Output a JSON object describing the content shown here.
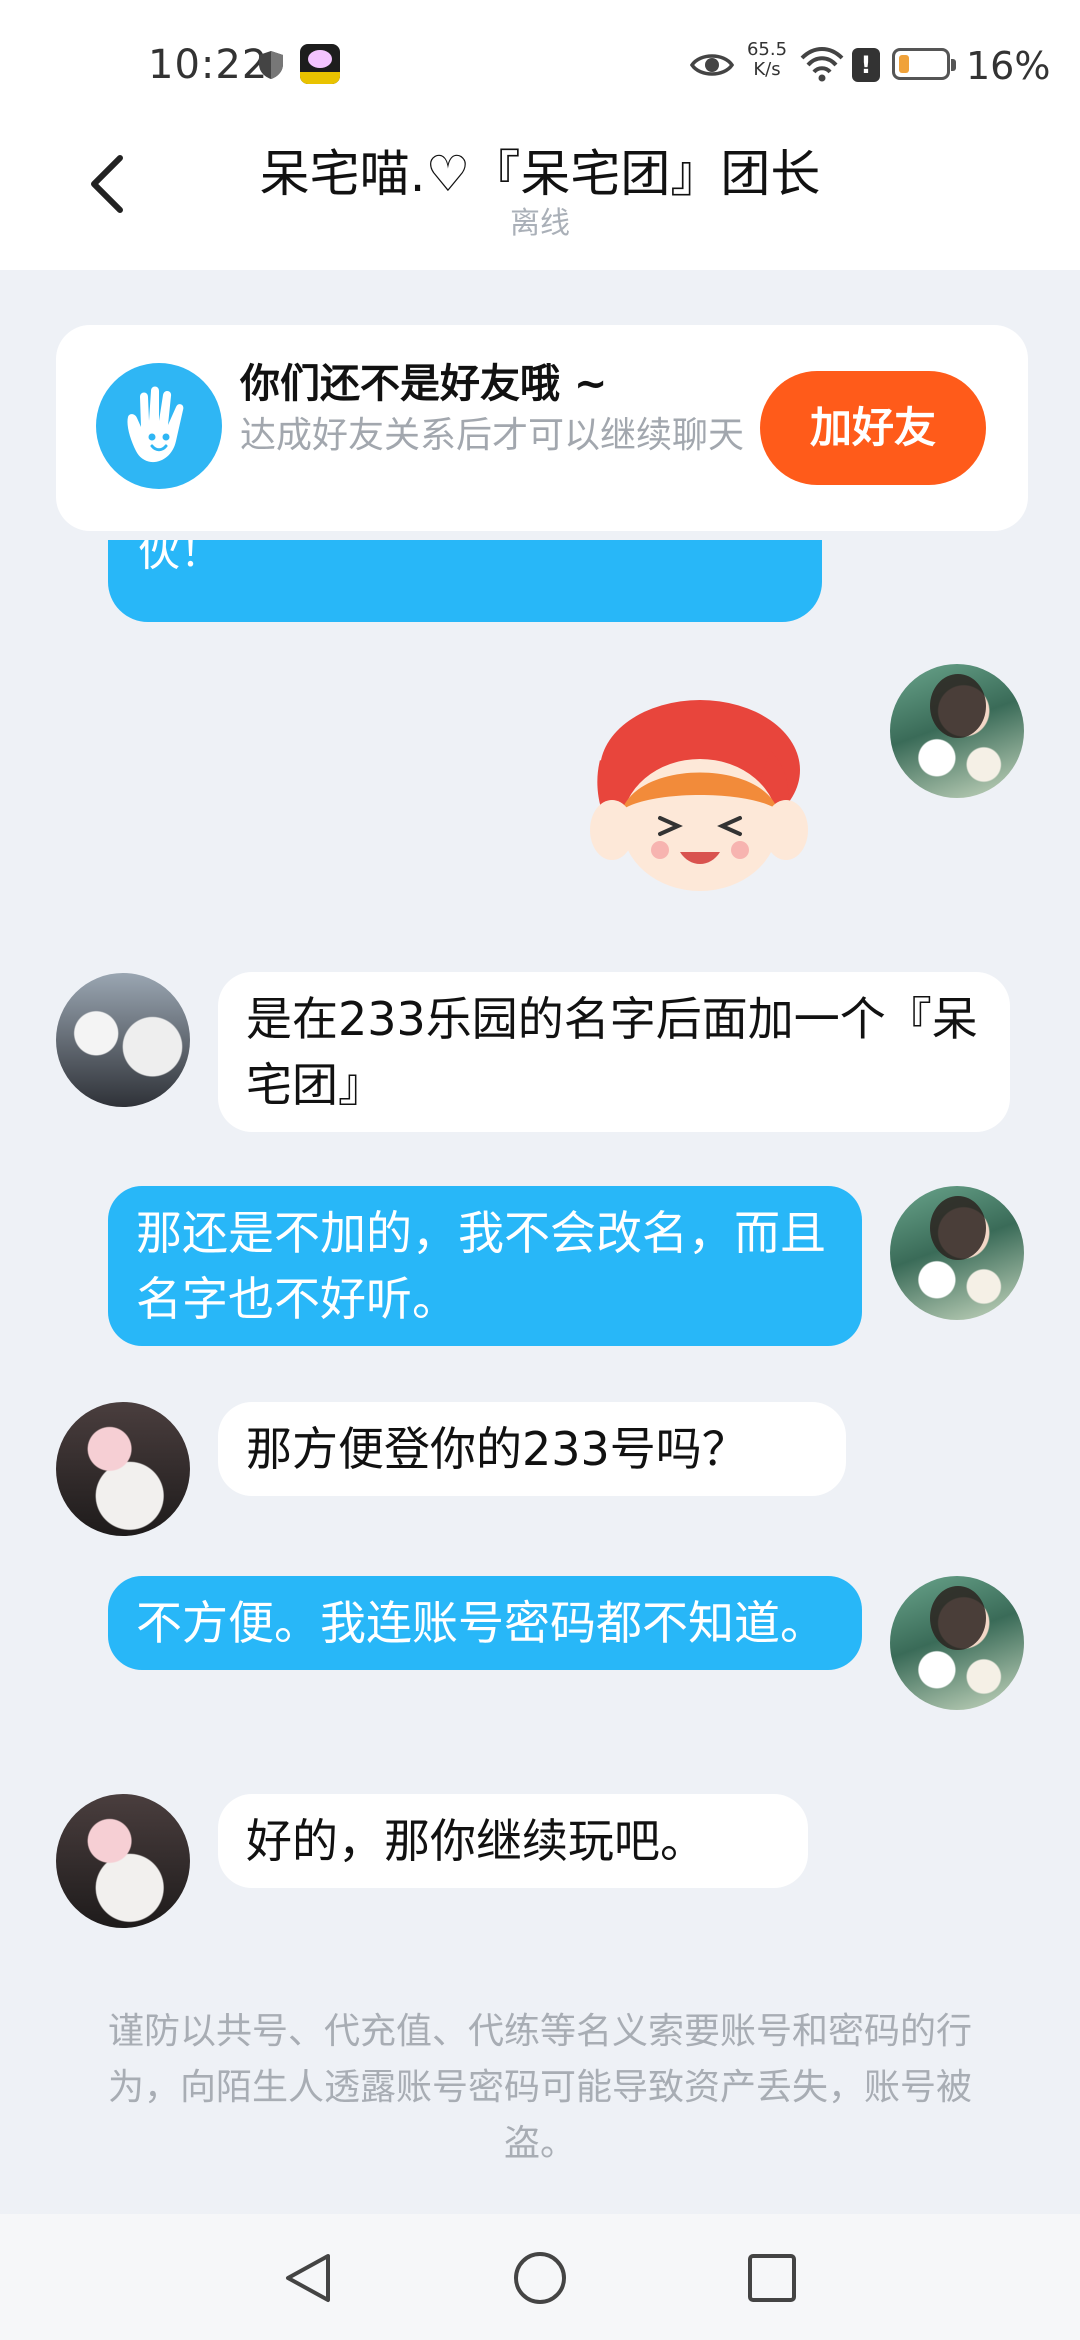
{
  "status_bar": {
    "time": "10:22",
    "net_speed_value": "65.5",
    "net_speed_unit": "K/s",
    "alert_glyph": "!",
    "battery_percent": "16%",
    "battery_level": 0.16,
    "icons": [
      "shield-icon",
      "app-icon",
      "eye-icon",
      "wifi-icon",
      "alert-icon",
      "battery-icon"
    ]
  },
  "header": {
    "title": "呆宅喵.♡『呆宅团』团长",
    "status": "离线"
  },
  "friend_banner": {
    "title": "你们还不是好友哦 ~",
    "subtitle": "达成好友关系后才可以继续聊天",
    "button_label": "加好友",
    "icon": "hand-icon",
    "accent_color": "#ff5b1a"
  },
  "messages": [
    {
      "side": "out",
      "type": "text",
      "text": "伙！",
      "partial": true
    },
    {
      "side": "out",
      "type": "sticker",
      "sticker": "cartoon-girl-sticker"
    },
    {
      "side": "in",
      "type": "text",
      "text": "是在233乐园的名字后面加一个『呆宅团』"
    },
    {
      "side": "out",
      "type": "text",
      "text": "那还是不加的，我不会改名，而且名字也不好听。"
    },
    {
      "side": "in",
      "type": "text",
      "text": "那方便登你的233号吗？"
    },
    {
      "side": "out",
      "type": "text",
      "text": "不方便。我连账号密码都不知道。"
    },
    {
      "side": "in",
      "type": "text",
      "text": "好的，那你继续玩吧。"
    }
  ],
  "warning": "谨防以共号、代充值、代练等名义索要账号和密码的行为，向陌生人透露账号密码可能导致资产丢失，账号被盗。",
  "colors": {
    "outgoing_bubble": "#28b7f8",
    "incoming_bubble": "#ffffff",
    "background": "#eef1f6"
  },
  "nav_bar": {
    "buttons": [
      "back-triangle-icon",
      "home-circle-icon",
      "recents-square-icon"
    ]
  }
}
